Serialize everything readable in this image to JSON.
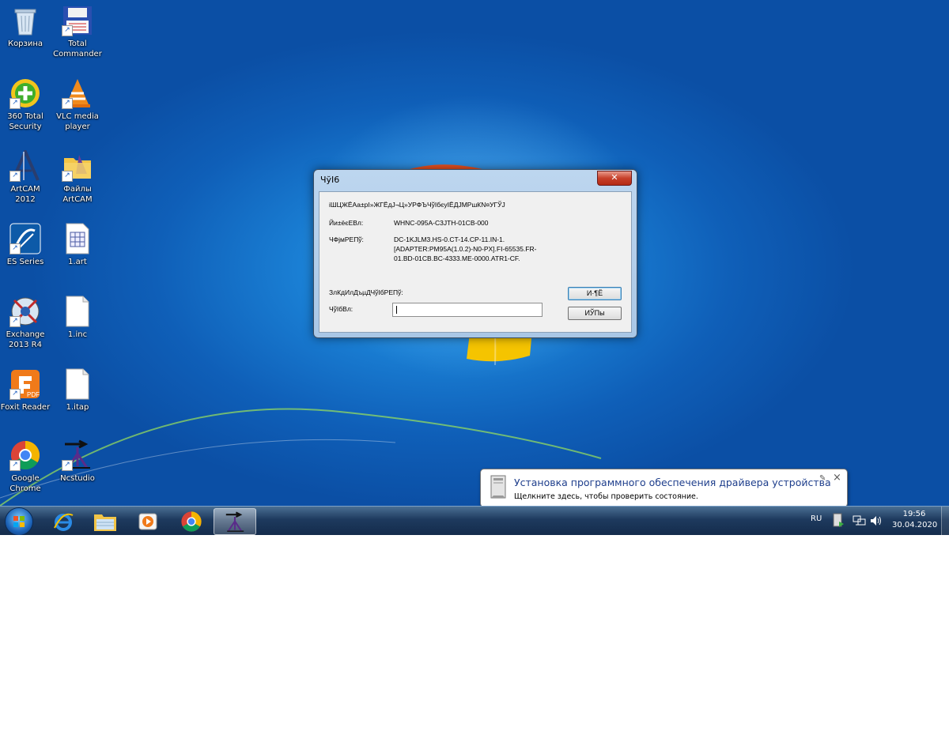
{
  "desktop_icons": [
    {
      "label": "Корзина",
      "icon": "recycle-bin-icon"
    },
    {
      "label": "Total Commander",
      "icon": "total-commander-icon"
    },
    {
      "label": "360 Total Security",
      "icon": "360-security-icon"
    },
    {
      "label": "VLC media player",
      "icon": "vlc-icon"
    },
    {
      "label": "ArtCAM 2012",
      "icon": "artcam-icon"
    },
    {
      "label": "Файлы ArtCAM",
      "icon": "folder-icon"
    },
    {
      "label": "ES Series",
      "icon": "es-series-icon"
    },
    {
      "label": "1.art",
      "icon": "art-file-icon"
    },
    {
      "label": "Exchange 2013 R4",
      "icon": "exchange-icon"
    },
    {
      "label": "1.inc",
      "icon": "blank-file-icon"
    },
    {
      "label": "Foxit Reader",
      "icon": "foxit-reader-icon"
    },
    {
      "label": "1.itap",
      "icon": "blank-file-icon"
    },
    {
      "label": "Google Chrome",
      "icon": "chrome-icon"
    },
    {
      "label": "Ncstudio",
      "icon": "ncstudio-icon"
    }
  ],
  "dialog": {
    "title": "ЧўІ6",
    "close_glyph": "✕",
    "header_text": "іШЦЖЁАа±рІ»ЖГЁдЈ¬Ц»УРФЪЧўІбєуІЁДЈМРшКN¤УГЎЈ",
    "label_1": "Йи±ёєЕВл:",
    "value_1": "WHNC-095A-C3JTH-01CB-000",
    "label_2": "ЧФјмРЕПў:",
    "value_2": [
      "DC-1KJLM3.HS-0.CT-14.CP-11.IN-1.",
      "[ADAPTER:PM95A(1.0.2)-N0-PX].FI-65535.FR-",
      "01.BD-01CB.BC-4333.ME-0000.ATR1-CF."
    ],
    "section_label": "ЗлКдИлДъµДЧўІбРЕПў:",
    "input_label": "ЧўІбВл:",
    "input_value": "",
    "ok_label": "И·¶Ё",
    "cancel_label": "ИЎПы"
  },
  "balloon": {
    "title": "Установка программного обеспечения драйвера устройства",
    "message": "Щелкните здесь, чтобы проверить состояние.",
    "close_glyph": "×"
  },
  "taskbar": {
    "items": [
      "start-orb",
      "internet-explorer",
      "windows-explorer",
      "media-player",
      "google-chrome",
      "ncstudio"
    ],
    "active_item": "ncstudio",
    "language": "RU",
    "time": "19:56",
    "date": "30.04.2020"
  },
  "colors": {
    "desktop": "#1a7fd4",
    "taskbar": "#1e3a5e",
    "balloon_title": "#1e3e8c"
  }
}
